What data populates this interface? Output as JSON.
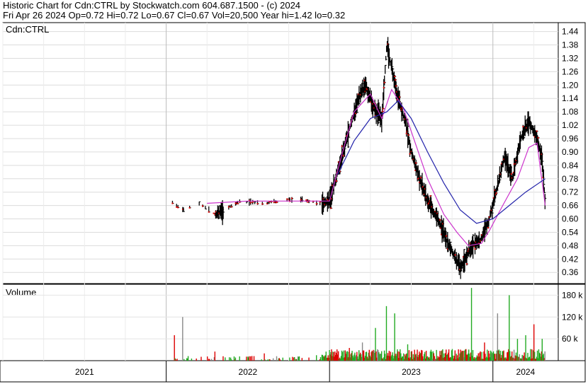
{
  "header": {
    "line1": "Historic Chart for Cdn:CTRL by Stockwatch.com  604.687.1500 - (c) 2024",
    "line2": "Fri Apr 26 2024   Op=0.72  Hi=0.72  Lo=0.67  Cl=0.67  Vol=20,500  Year hi=1.42  lo=0.32"
  },
  "chart_data": [
    {
      "type": "line",
      "title": "Cdn:CTRL",
      "yticks": [
        "1.44",
        "1.38",
        "1.32",
        "1.26",
        "1.20",
        "1.14",
        "1.08",
        "1.02",
        "0.96",
        "0.90",
        "0.84",
        "0.78",
        "0.72",
        "0.66",
        "0.60",
        "0.54",
        "0.48",
        "0.42",
        "0.36"
      ],
      "ylim": [
        0.31,
        1.48
      ],
      "xlim": [
        2021.0,
        2024.4
      ],
      "year_labels": [
        "2021",
        "2022",
        "2023",
        "2024"
      ],
      "year_boundaries": [
        2022.0,
        2023.0,
        2024.0
      ],
      "grid": true,
      "price_path": {
        "x": [
          2022.03,
          2022.1,
          2022.2,
          2022.3,
          2022.45,
          2022.6,
          2022.8,
          2022.95,
          2023.0,
          2023.06,
          2023.12,
          2023.18,
          2023.22,
          2023.27,
          2023.32,
          2023.35,
          2023.42,
          2023.47,
          2023.5,
          2023.55,
          2023.6,
          2023.66,
          2023.72,
          2023.8,
          2023.87,
          2023.92,
          2023.97,
          2024.02,
          2024.07,
          2024.12,
          2024.17,
          2024.22,
          2024.27,
          2024.3,
          2024.32
        ],
        "y": [
          0.68,
          0.64,
          0.67,
          0.62,
          0.68,
          0.67,
          0.69,
          0.67,
          0.68,
          0.84,
          1.0,
          1.15,
          1.2,
          1.1,
          1.05,
          1.38,
          1.14,
          1.02,
          0.9,
          0.78,
          0.68,
          0.6,
          0.5,
          0.38,
          0.48,
          0.5,
          0.58,
          0.72,
          0.88,
          0.78,
          0.96,
          1.04,
          0.96,
          0.88,
          0.67
        ]
      },
      "series": [
        {
          "name": "",
          "color": "#cc33cc",
          "x": [
            2022.25,
            2022.5,
            2022.8,
            2023.0,
            2023.08,
            2023.15,
            2023.25,
            2023.32,
            2023.38,
            2023.45,
            2023.52,
            2023.6,
            2023.7,
            2023.78,
            2023.85,
            2023.93,
            2023.98,
            2024.06,
            2024.15,
            2024.22,
            2024.27,
            2024.32
          ],
          "y": [
            0.67,
            0.68,
            0.68,
            0.68,
            0.9,
            1.08,
            1.16,
            1.05,
            1.18,
            1.1,
            0.95,
            0.78,
            0.62,
            0.54,
            0.48,
            0.49,
            0.55,
            0.66,
            0.78,
            0.92,
            0.94,
            0.66
          ]
        },
        {
          "name": "",
          "color": "#2222aa",
          "x": [
            2023.05,
            2023.15,
            2023.25,
            2023.35,
            2023.42,
            2023.5,
            2023.6,
            2023.7,
            2023.8,
            2023.9,
            2024.0,
            2024.1,
            2024.2,
            2024.32
          ],
          "y": [
            0.8,
            0.95,
            1.05,
            1.08,
            1.13,
            1.05,
            0.9,
            0.76,
            0.64,
            0.58,
            0.6,
            0.66,
            0.72,
            0.78
          ]
        }
      ]
    },
    {
      "type": "bar",
      "title": "Volume",
      "yticks": [
        "180 k",
        "120 k",
        "60 k"
      ],
      "ylim": [
        0,
        210
      ],
      "spikes": {
        "x": [
          2022.05,
          2022.1,
          2022.3,
          2022.6,
          2022.92,
          2023.02,
          2023.12,
          2023.2,
          2023.28,
          2023.35,
          2023.4,
          2023.48,
          2023.55,
          2023.62,
          2023.7,
          2023.78,
          2023.87,
          2023.95,
          2024.03,
          2024.1,
          2024.15,
          2024.2,
          2024.25,
          2024.3
        ],
        "values": [
          70,
          120,
          25,
          20,
          15,
          25,
          35,
          50,
          90,
          150,
          130,
          45,
          25,
          30,
          20,
          15,
          200,
          50,
          130,
          180,
          60,
          70,
          100,
          60
        ]
      }
    }
  ]
}
